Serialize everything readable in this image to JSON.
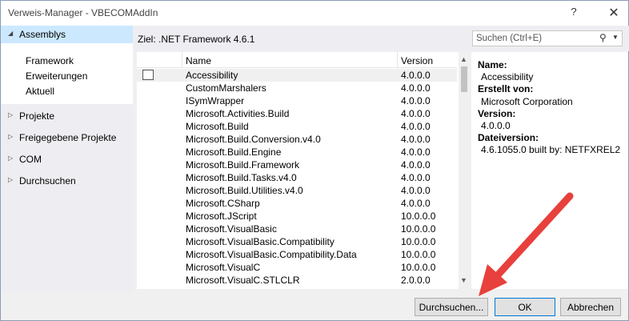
{
  "window": {
    "title": "Verweis-Manager - VBECOMAddIn",
    "help_glyph": "?",
    "close_glyph": "✕"
  },
  "sidebar": {
    "assemblies_label": "Assemblys",
    "sub_items": [
      "Framework",
      "Erweiterungen",
      "Aktuell"
    ],
    "items": [
      "Projekte",
      "Freigegebene Projekte",
      "COM",
      "Durchsuchen"
    ]
  },
  "target": {
    "label": "Ziel: .NET Framework 4.6.1"
  },
  "search": {
    "placeholder": "Suchen (Ctrl+E)"
  },
  "table": {
    "headers": {
      "name": "Name",
      "version": "Version"
    },
    "rows": [
      {
        "name": "Accessibility",
        "version": "4.0.0.0"
      },
      {
        "name": "CustomMarshalers",
        "version": "4.0.0.0"
      },
      {
        "name": "ISymWrapper",
        "version": "4.0.0.0"
      },
      {
        "name": "Microsoft.Activities.Build",
        "version": "4.0.0.0"
      },
      {
        "name": "Microsoft.Build",
        "version": "4.0.0.0"
      },
      {
        "name": "Microsoft.Build.Conversion.v4.0",
        "version": "4.0.0.0"
      },
      {
        "name": "Microsoft.Build.Engine",
        "version": "4.0.0.0"
      },
      {
        "name": "Microsoft.Build.Framework",
        "version": "4.0.0.0"
      },
      {
        "name": "Microsoft.Build.Tasks.v4.0",
        "version": "4.0.0.0"
      },
      {
        "name": "Microsoft.Build.Utilities.v4.0",
        "version": "4.0.0.0"
      },
      {
        "name": "Microsoft.CSharp",
        "version": "4.0.0.0"
      },
      {
        "name": "Microsoft.JScript",
        "version": "10.0.0.0"
      },
      {
        "name": "Microsoft.VisualBasic",
        "version": "10.0.0.0"
      },
      {
        "name": "Microsoft.VisualBasic.Compatibility",
        "version": "10.0.0.0"
      },
      {
        "name": "Microsoft.VisualBasic.Compatibility.Data",
        "version": "10.0.0.0"
      },
      {
        "name": "Microsoft.VisualC",
        "version": "10.0.0.0"
      },
      {
        "name": "Microsoft.VisualC.STLCLR",
        "version": "2.0.0.0"
      }
    ]
  },
  "details": {
    "name_label": "Name:",
    "name_value": "Accessibility",
    "creator_label": "Erstellt von:",
    "creator_value": "Microsoft Corporation",
    "version_label": "Version:",
    "version_value": "4.0.0.0",
    "fileversion_label": "Dateiversion:",
    "fileversion_value": "4.6.1055.0 built by: NETFXREL2"
  },
  "buttons": {
    "browse": "Durchsuchen...",
    "ok": "OK",
    "cancel": "Abbrechen"
  },
  "colors": {
    "selection": "#cce8ff",
    "annotation_arrow": "#e8403c"
  }
}
